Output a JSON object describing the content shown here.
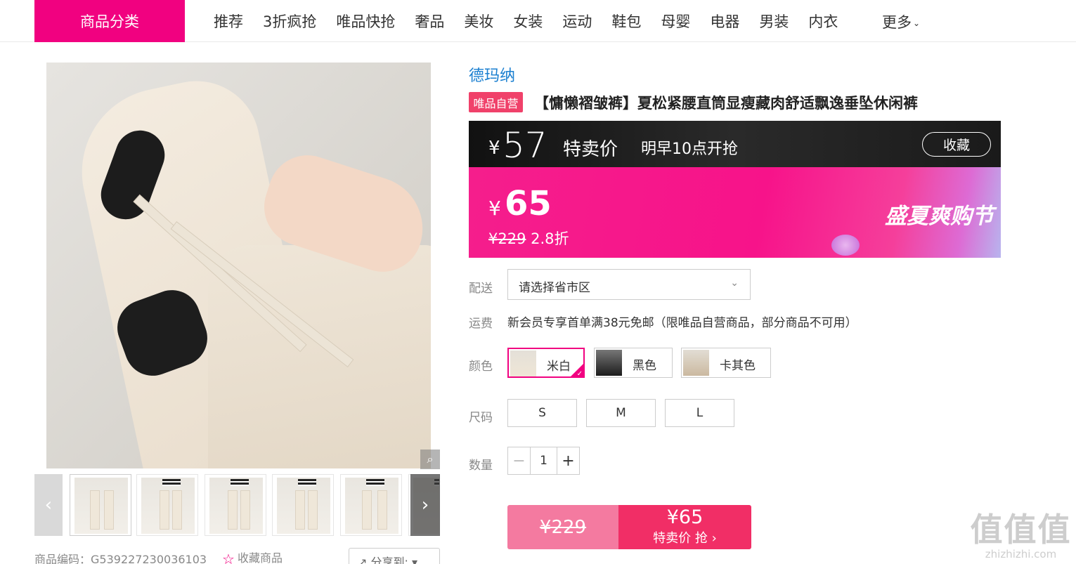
{
  "nav": {
    "category_label": "商品分类",
    "items": [
      "推荐",
      "3折疯抢",
      "唯品快抢",
      "奢品",
      "美妆",
      "女装",
      "运动",
      "鞋包",
      "母婴",
      "电器",
      "男装",
      "内衣"
    ],
    "more_label": "更多"
  },
  "gallery": {
    "thumbnail_count": 6
  },
  "product": {
    "brand": "德玛纳",
    "self_badge": "唯品自营",
    "title": "【慵懒褶皱裤】夏松紧腰直筒显瘦藏肉舒适飘逸垂坠休闲裤",
    "sku_code": "商品编码：G539227230036103",
    "fav_link": "收藏商品",
    "share_label": "分享到:"
  },
  "price_banner": {
    "yen": "¥",
    "flash_price": "57",
    "flash_label": "特卖价",
    "flash_time": "明早10点开抢",
    "fav_button": "收藏",
    "current_price": "65",
    "original_price": "¥229",
    "discount": "2.8折",
    "event_name": "盛夏爽购节"
  },
  "delivery": {
    "label": "配送",
    "placeholder": "请选择省市区"
  },
  "shipping": {
    "label": "运费",
    "text": "新会员专享首单满38元免邮（限唯品自营商品，部分商品不可用）"
  },
  "colors": {
    "label": "颜色",
    "options": [
      {
        "name": "米白",
        "selected": true,
        "swatch": "#efe6d6"
      },
      {
        "name": "黑色",
        "selected": false,
        "swatch": "#1c1c1c"
      },
      {
        "name": "卡其色",
        "selected": false,
        "swatch": "#cbb9a0"
      }
    ]
  },
  "sizes": {
    "label": "尺码",
    "options": [
      "S",
      "M",
      "L"
    ]
  },
  "quantity": {
    "label": "数量",
    "value": "1",
    "minus": "−",
    "plus": "+"
  },
  "buy": {
    "original_price": "¥229",
    "price": "¥65",
    "label": "特卖价 抢 ›"
  },
  "watermark": {
    "logo": "值值值",
    "url": "zhizhizhi.com"
  },
  "colors_theme": {
    "accent": "#f10180",
    "brand_link": "#1a7fd0",
    "buy_button": "#f12e66"
  }
}
